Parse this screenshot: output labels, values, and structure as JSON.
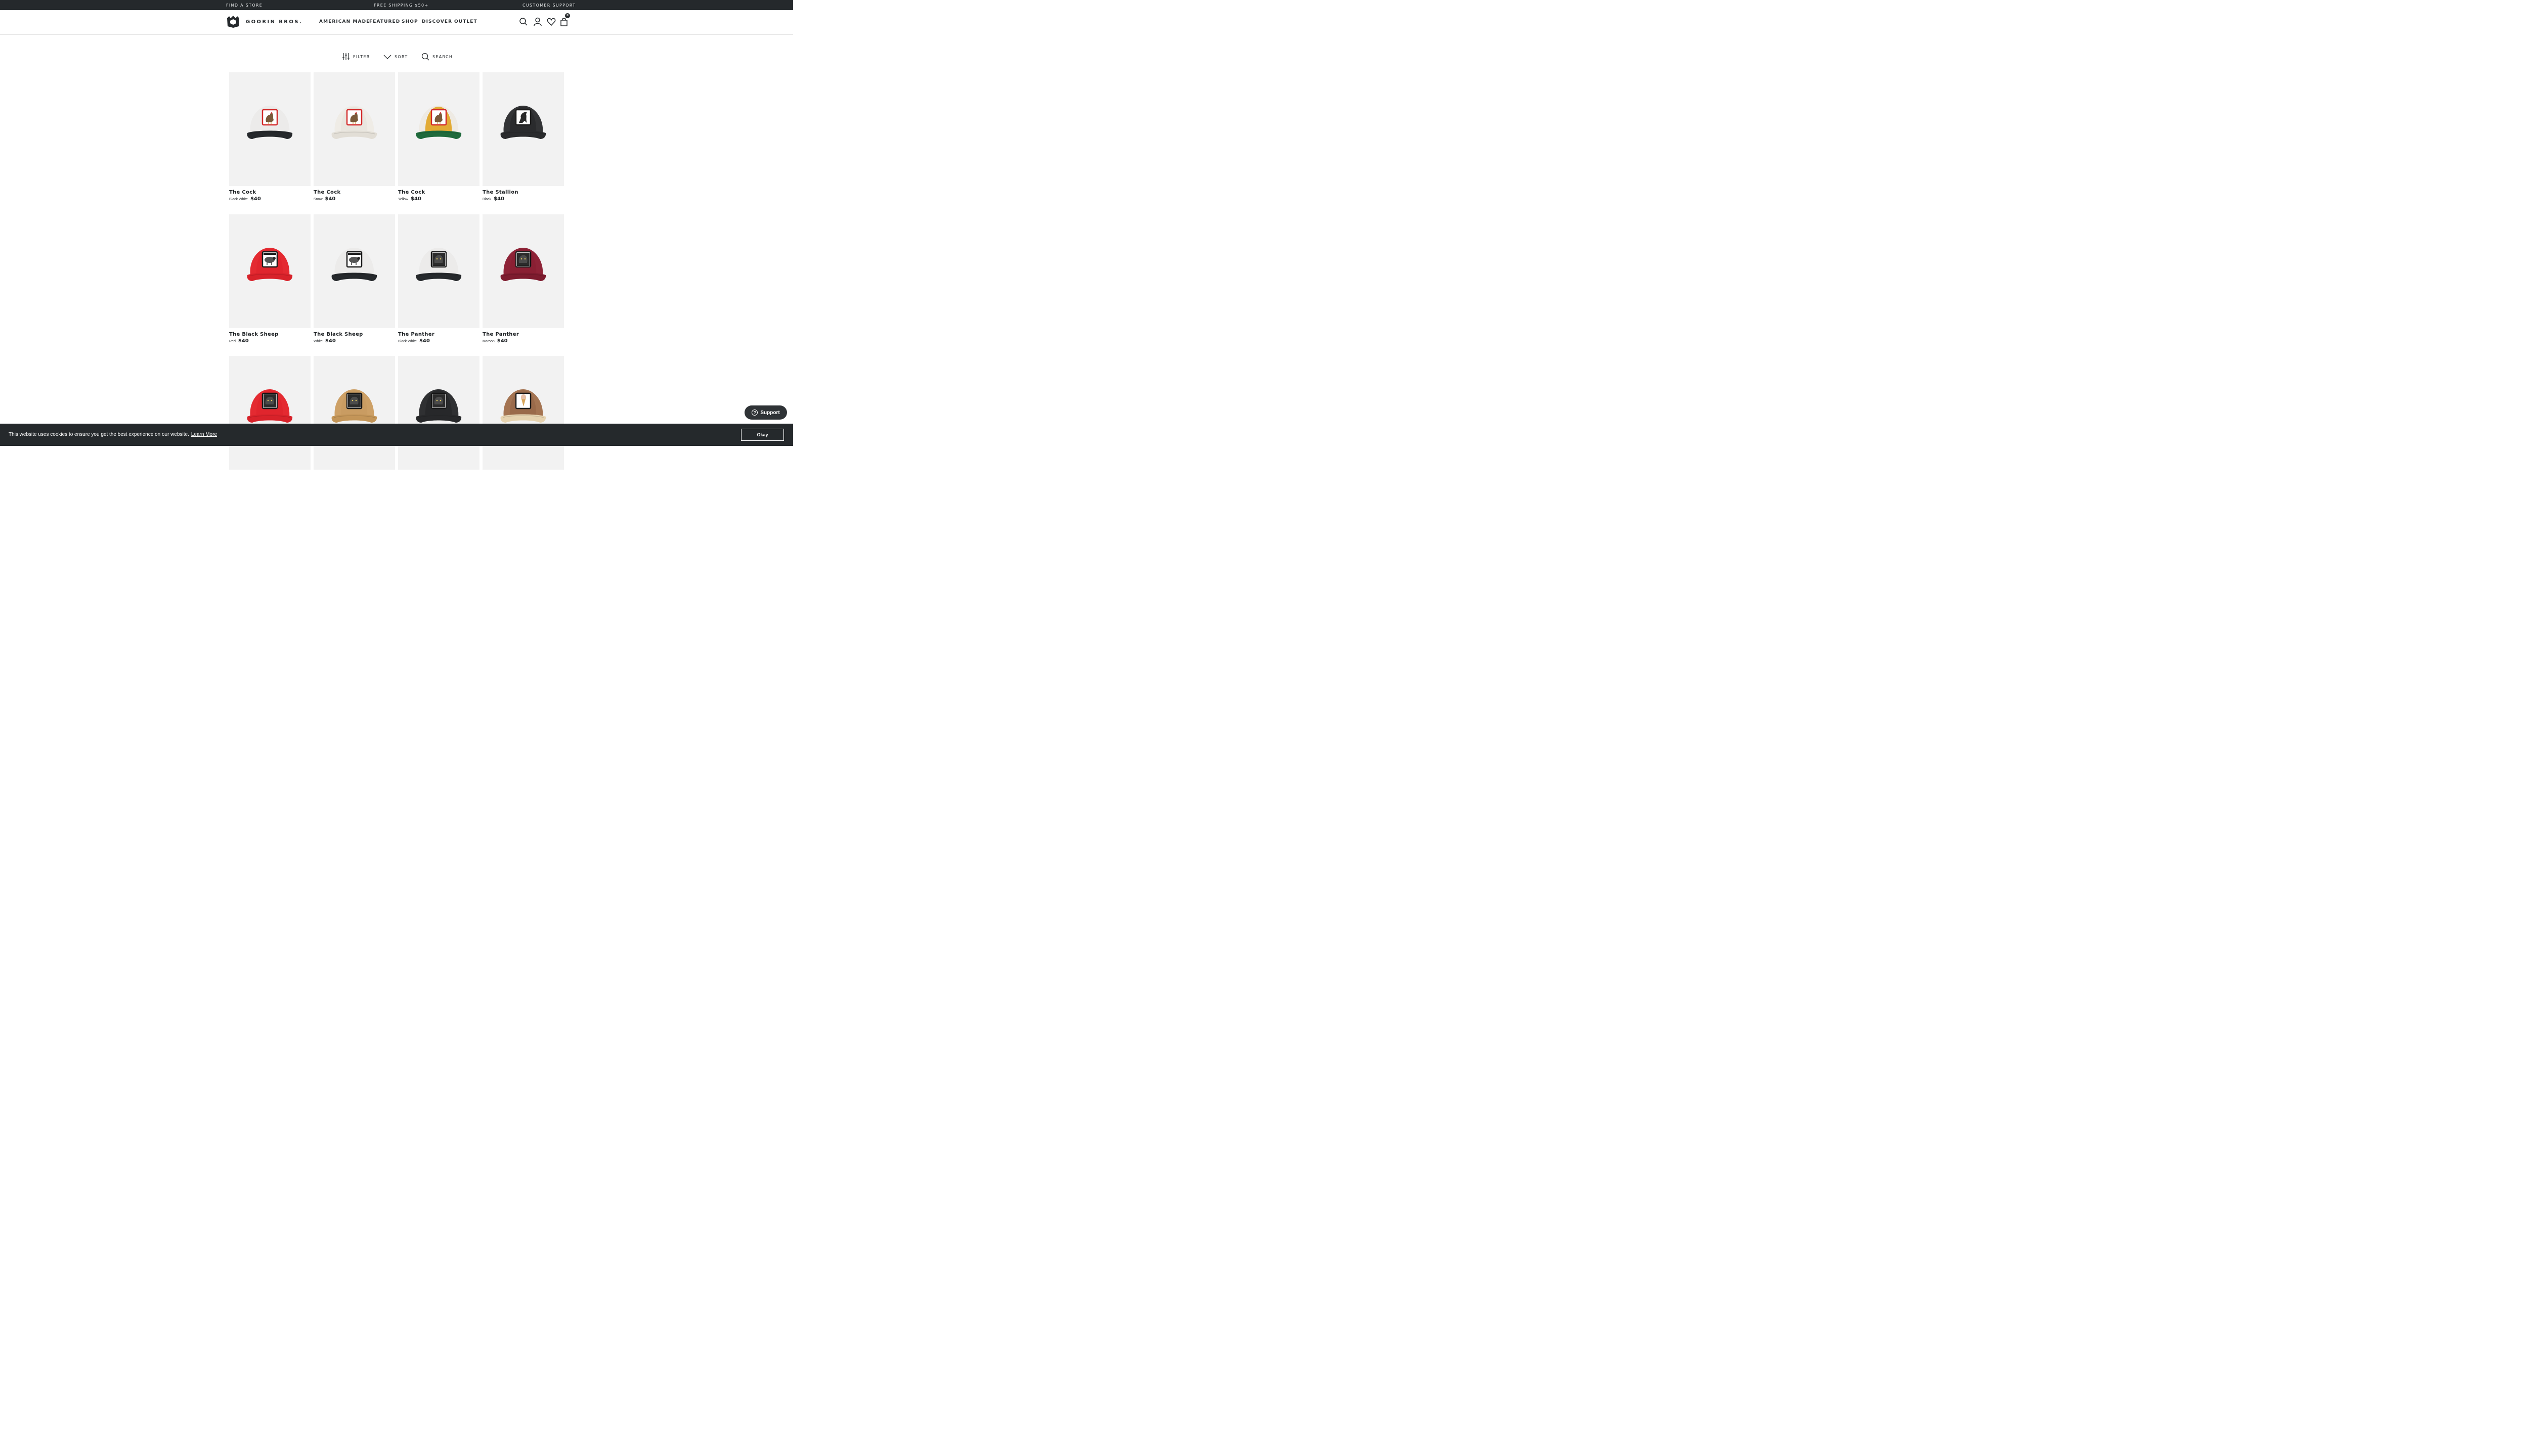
{
  "topbar": {
    "find_store": "FIND A STORE",
    "shipping": "FREE SHIPPING $50+",
    "support": "CUSTOMER SUPPORT"
  },
  "header": {
    "brand": "GOORIN BROS.",
    "nav": [
      "AMERICAN MADE",
      "FEATURED",
      "SHOP",
      "DISCOVER",
      "OUTLET"
    ],
    "cart_count": "0",
    "icons": [
      "search-icon",
      "account-icon",
      "wishlist-heart-icon",
      "cart-bag-icon"
    ]
  },
  "tools": {
    "filter": "FILTER",
    "sort": "SORT",
    "search": "SEARCH"
  },
  "products": [
    {
      "name": "The Cock",
      "color": "Black White",
      "price": "$40",
      "crown": "#ecebea",
      "brim": "#26292c",
      "mesh": "#ecebea",
      "patch": "rooster-red"
    },
    {
      "name": "The Cock",
      "color": "Snow",
      "price": "$40",
      "crown": "#e9e6df",
      "brim": "#e2ded6",
      "mesh": "#efece6",
      "patch": "rooster-red"
    },
    {
      "name": "The Cock",
      "color": "Yellow",
      "price": "$40",
      "crown": "#e2aa33",
      "brim": "#1f6a3c",
      "mesh": "#eeeae3",
      "patch": "rooster-red"
    },
    {
      "name": "The Stallion",
      "color": "Black",
      "price": "$40",
      "crown": "#2a2b2d",
      "brim": "#2a2b2d",
      "mesh": "#333436",
      "patch": "stallion"
    },
    {
      "name": "The Black Sheep",
      "color": "Red",
      "price": "$40",
      "crown": "#e0252d",
      "brim": "#d8222a",
      "mesh": "#e42a31",
      "patch": "sheep"
    },
    {
      "name": "The Black Sheep",
      "color": "White",
      "price": "$40",
      "crown": "#ecebea",
      "brim": "#26292c",
      "mesh": "#ecebea",
      "patch": "sheep"
    },
    {
      "name": "The Panther",
      "color": "Black White",
      "price": "$40",
      "crown": "#ecebea",
      "brim": "#26292c",
      "mesh": "#ecebea",
      "patch": "panther"
    },
    {
      "name": "The Panther",
      "color": "Maroon",
      "price": "$40",
      "crown": "#8a1f33",
      "brim": "#7d1b2e",
      "mesh": "#8e2337",
      "patch": "panther"
    },
    {
      "name": "",
      "color": "",
      "price": "",
      "crown": "#e0252d",
      "brim": "#d8222a",
      "mesh": "#e42a31",
      "patch": "panther"
    },
    {
      "name": "",
      "color": "",
      "price": "",
      "crown": "#c99c62",
      "brim": "#c39558",
      "mesh": "#cda066",
      "patch": "panther"
    },
    {
      "name": "",
      "color": "",
      "price": "",
      "crown": "#27282a",
      "brim": "#27282a",
      "mesh": "#2f3032",
      "patch": "panther"
    },
    {
      "name": "",
      "color": "",
      "price": "",
      "crown": "#9a6a4a",
      "brim": "#e6d3b0",
      "mesh": "#a47452",
      "patch": "rocky"
    }
  ],
  "support_button": "Support",
  "cookie": {
    "message": "This website uses cookies to ensure you get the best experience on our website.",
    "learn_more": "Learn More",
    "okay": "Okay"
  }
}
